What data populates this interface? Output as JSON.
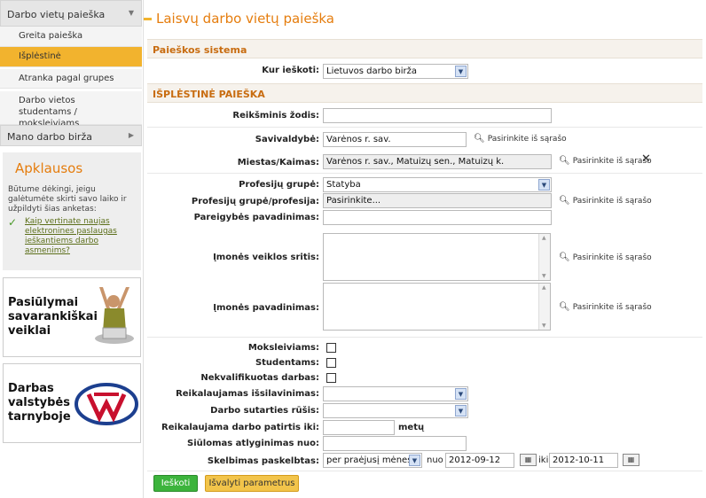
{
  "sidebar": {
    "section1_title": "Darbo vietų paieška",
    "items": [
      {
        "label": "Greita paieška"
      },
      {
        "label": "Išplėstinė"
      },
      {
        "label": "Atranka pagal grupes"
      },
      {
        "label": "Darbo vietos studentams / moksleiviams"
      }
    ],
    "section2_title": "Mano darbo birža"
  },
  "poll": {
    "title": "Apklausos",
    "text": "Būtume dėkingi, jeigu galėtumėte skirti savo laiko ir užpildyti šias anketas:",
    "link": "Kaip vertinate naujas elektronines paslaugas ieškantiems darbo asmenims?"
  },
  "banners": [
    {
      "text": "Pasiūlymai savarankiškai veiklai"
    },
    {
      "text": "Darbas valstybės tarnyboje"
    }
  ],
  "page": {
    "title": "Laisvų darbo vietų paieška",
    "section_system": "Paieškos sistema",
    "section_advanced": "IŠPLĖSTINĖ PAIEŠKA"
  },
  "form": {
    "where_label": "Kur ieškoti:",
    "where_value": "Lietuvos darbo birža",
    "keyword_label": "Reikšminis žodis:",
    "keyword_value": "",
    "municipality_label": "Savivaldybė:",
    "municipality_value": "Varėnos r. sav.",
    "city_label": "Miestas/Kaimas:",
    "city_value": "Varėnos r. sav., Matuizų sen., Matuizų k.",
    "prof_group_label": "Profesijų grupė:",
    "prof_group_value": "Statyba",
    "prof_label": "Profesijų grupė/profesija:",
    "prof_value": "Pasirinkite...",
    "position_label": "Pareigybės pavadinimas:",
    "activity_label": "Įmonės veiklos sritis:",
    "company_label": "Įmonės pavadinimas:",
    "pupils_label": "Moksleiviams:",
    "students_label": "Studentams:",
    "unqualified_label": "Nekvalifikuotas darbas:",
    "education_label": "Reikalaujamas išsilavinimas:",
    "contract_label": "Darbo sutarties rūšis:",
    "experience_label": "Reikalaujama darbo patirtis iki:",
    "experience_unit": "metų",
    "salary_label": "Siūlomas atlyginimas nuo:",
    "published_label": "Skelbimas paskelbtas:",
    "published_value": "per praėjusį mėnesį",
    "from_label": "nuo",
    "from_date": "2012-09-12",
    "to_label": "iki",
    "to_date": "2012-10-11",
    "pick_label": "Pasirinkite iš sąrašo"
  },
  "buttons": {
    "search": "Ieškoti",
    "clear": "Išvalyti parametrus"
  }
}
